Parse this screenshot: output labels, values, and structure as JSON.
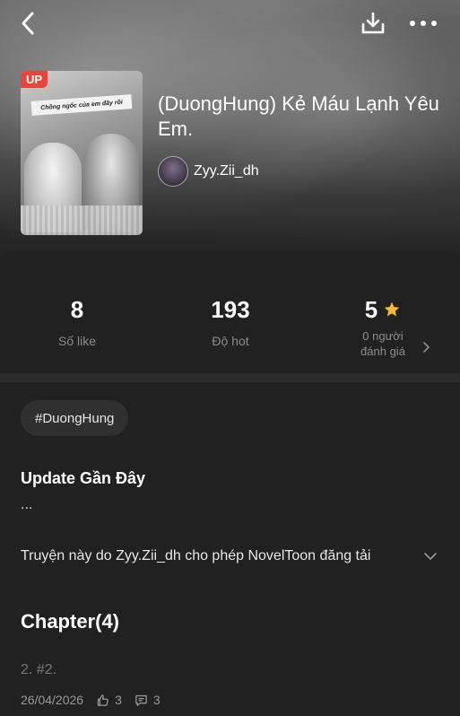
{
  "header": {
    "back_icon": "chevron-left-icon",
    "download_icon": "download-icon",
    "more_icon": "more-horizontal-icon"
  },
  "book": {
    "cover_badge": "UP",
    "cover_caption": "Chồng ngốc của em đây rồi",
    "title": "(DuongHung) Kẻ Máu Lạnh Yêu Em.",
    "author": "Zyy.Zii_dh"
  },
  "stats": {
    "likes_value": "8",
    "likes_label": "Số like",
    "hot_value": "193",
    "hot_label": "Độ hot",
    "rating_value": "5",
    "rating_count_line1": "0 người",
    "rating_count_line2": "đánh giá",
    "star_color": "#f5b82e"
  },
  "tags": [
    "#DuongHung"
  ],
  "update": {
    "heading": "Update Gần Đây",
    "text": "..."
  },
  "permission_text": "Truyện này do Zyy.Zii_dh cho phép NovelToon đăng tải",
  "chapters": {
    "heading": "Chapter(4)",
    "latest": {
      "title": "2. #2.",
      "date": "26/04/2026",
      "likes": "3",
      "comments": "3"
    }
  }
}
